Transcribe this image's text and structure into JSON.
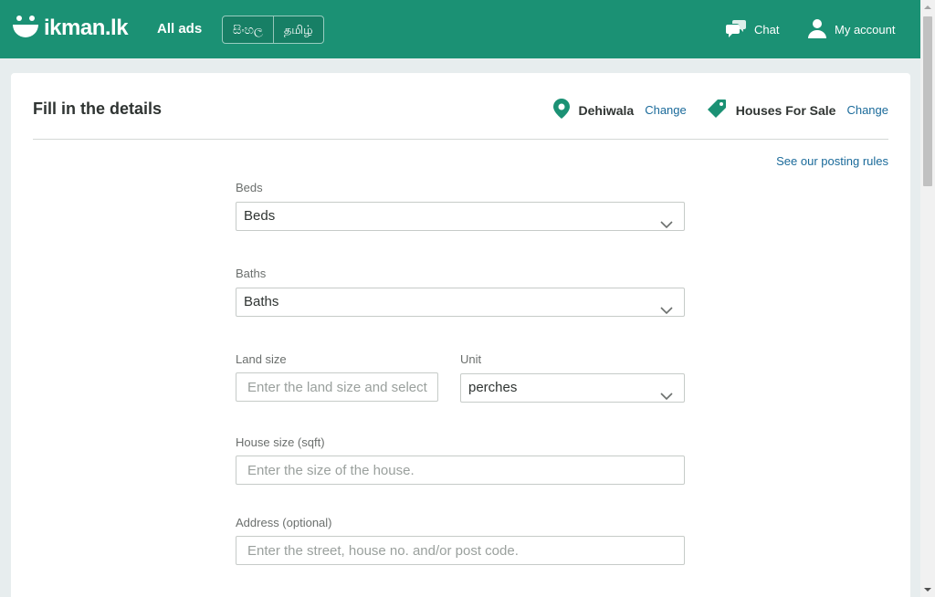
{
  "header": {
    "logo_text": "ikman.lk",
    "all_ads": "All ads",
    "languages": [
      "සිංහල",
      "தமிழ்"
    ],
    "chat": "Chat",
    "my_account": "My account"
  },
  "colors": {
    "brand": "#1b9174",
    "link": "#1a6a9a",
    "icon_green": "#1b9174"
  },
  "form": {
    "title": "Fill in the details",
    "location": {
      "name": "Dehiwala",
      "change": "Change",
      "icon": "location-pin-icon"
    },
    "category": {
      "name": "Houses For Sale",
      "change": "Change",
      "icon": "tag-icon"
    },
    "posting_rules": "See our posting rules",
    "beds": {
      "label": "Beds",
      "value": "Beds"
    },
    "baths": {
      "label": "Baths",
      "value": "Baths"
    },
    "land_size": {
      "label": "Land size",
      "placeholder": "Enter the land size and select"
    },
    "unit": {
      "label": "Unit",
      "value": "perches"
    },
    "house_size": {
      "label": "House size (sqft)",
      "placeholder": "Enter the size of the house."
    },
    "address": {
      "label": "Address (optional)",
      "placeholder": "Enter the street, house no. and/or post code."
    }
  }
}
